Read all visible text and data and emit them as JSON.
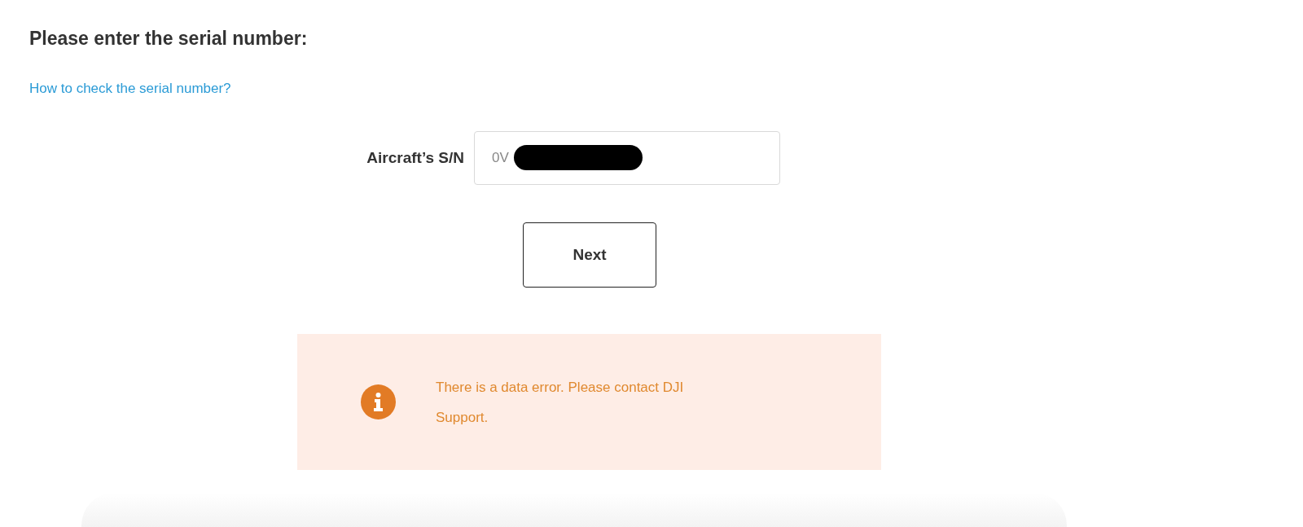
{
  "heading": "Please enter the serial number:",
  "help_link": "How to check the serial number?",
  "serial_field": {
    "label": "Aircraft’s S/N",
    "value": "0V",
    "redacted": true
  },
  "next_button": "Next",
  "alert": {
    "kind": "info",
    "message": "There is a data error. Please contact DJI Support."
  }
}
